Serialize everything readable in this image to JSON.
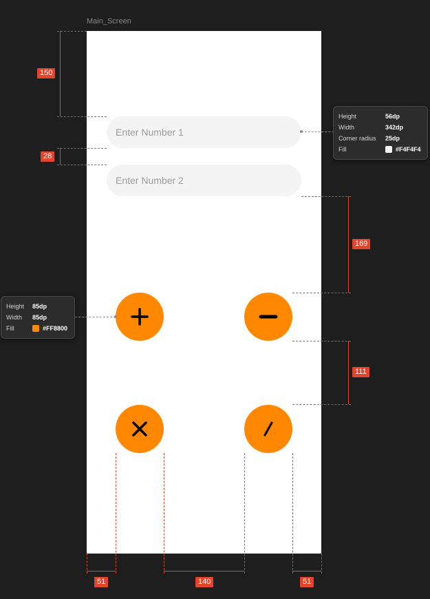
{
  "frame": {
    "label": "Main_Screen"
  },
  "inputs": [
    {
      "placeholder": "Enter Number 1"
    },
    {
      "placeholder": "Enter Number 2"
    }
  ],
  "operators": [
    {
      "symbol": "plus-icon",
      "color": "#FF8800"
    },
    {
      "symbol": "minus-icon",
      "color": "#FF8800"
    },
    {
      "symbol": "multiply-icon",
      "color": "#FF8800"
    },
    {
      "symbol": "divide-icon",
      "color": "#FF8800"
    }
  ],
  "measurements": {
    "top_margin": "150",
    "input_gap": "28",
    "inputs_to_buttons": "169",
    "row_gap": "111",
    "left_margin": "51",
    "column_gap": "140",
    "right_margin": "51"
  },
  "input_spec": {
    "height_label": "Height",
    "height_value": "56dp",
    "width_label": "Width",
    "width_value": "342dp",
    "radius_label": "Corner radius",
    "radius_value": "25dp",
    "fill_label": "Fill",
    "fill_value": "#F4F4F4",
    "fill_color": "#F4F4F4"
  },
  "button_spec": {
    "height_label": "Height",
    "height_value": "85dp",
    "width_label": "Width",
    "width_value": "85dp",
    "fill_label": "Fill",
    "fill_value": "#FF8800",
    "fill_color": "#FF8800"
  }
}
